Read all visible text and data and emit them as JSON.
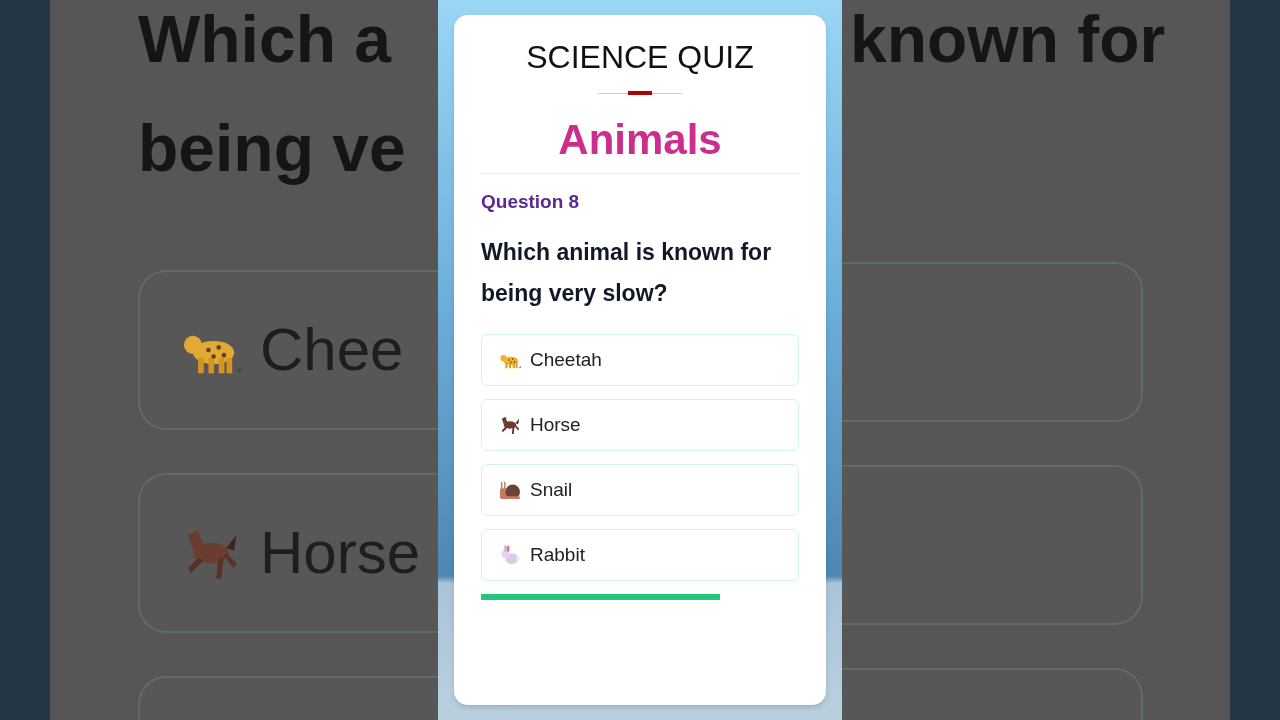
{
  "background": {
    "question_lines": [
      "Which a",
      "being ve"
    ],
    "right_line": "known for",
    "options": [
      "Chee",
      "Horse"
    ]
  },
  "quiz": {
    "title": "SCIENCE QUIZ",
    "topic": "Animals",
    "question_label": "Question 8",
    "question": "Which animal is known for being very slow?",
    "options": [
      {
        "label": "Cheetah"
      },
      {
        "label": "Horse"
      },
      {
        "label": "Snail"
      },
      {
        "label": "Rabbit"
      }
    ],
    "progress": {
      "level": 0.75
    }
  }
}
